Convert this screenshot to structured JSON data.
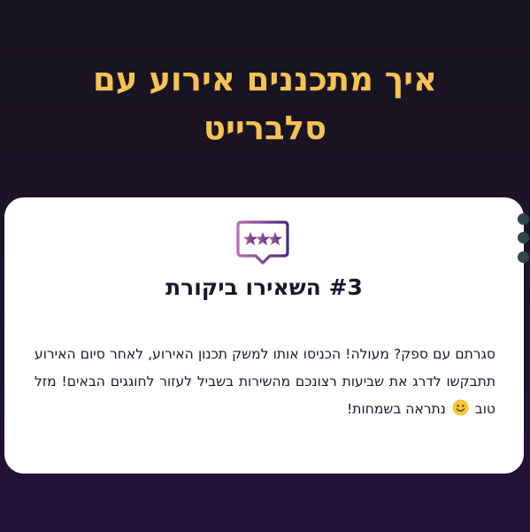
{
  "page": {
    "title": "איך מתכננים אירוע עם סלברייט"
  },
  "card": {
    "icon": "review-stars-speech-bubble-icon",
    "heading": "#3 השאירו ביקורת",
    "paragraph_part1": "סגרתם עם ספק? מעולה! הכניסו אותו למשק תכנון האירוע, לאחר סיום האירוע תתבקשו לדרג את שביעות רצונכם מהשירות בשביל לעזור לחוגגים הבאים! מזל טוב",
    "emoji_icon": "smiling-face-emoji-icon",
    "paragraph_part2": "נתראה בשמחות!"
  },
  "carousel": {
    "dot_count": 3
  },
  "colors": {
    "title": "#f7c253",
    "text": "#1b1730",
    "card_background": "#ffffff",
    "dot": "#2f4650",
    "icon_gradient_start": "#b86ab0",
    "icon_gradient_end": "#4a2a78"
  }
}
